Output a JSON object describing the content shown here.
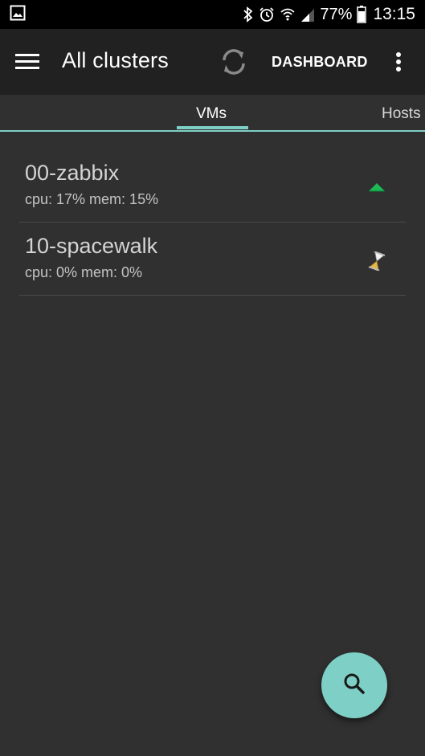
{
  "status_bar": {
    "battery_percent": "77%",
    "time": "13:15",
    "icons": [
      "gallery-icon",
      "bluetooth-icon",
      "alarm-icon",
      "wifi-icon",
      "signal-icon",
      "battery-icon"
    ]
  },
  "app_bar": {
    "title": "All clusters",
    "dashboard_label": "DASHBOARD",
    "icons": [
      "menu-icon",
      "refresh-icon",
      "overflow-menu-icon"
    ]
  },
  "tabs": [
    {
      "label": "VMs",
      "selected": true
    },
    {
      "label": "Hosts",
      "selected": false
    }
  ],
  "vms": [
    {
      "name": "00-zabbix",
      "stats": "cpu: 17% mem: 15%",
      "status_icon": "status-up-icon",
      "status_color": "#1db954"
    },
    {
      "name": "10-spacewalk",
      "stats": "cpu: 0% mem: 0%",
      "status_icon": "hourglass-icon",
      "status_color": "#e0b84a"
    }
  ],
  "fab": {
    "icon": "search-icon"
  },
  "colors": {
    "accent": "#7ecfc5",
    "background": "#303030",
    "app_bar": "#212121",
    "status_bar": "#000000"
  }
}
